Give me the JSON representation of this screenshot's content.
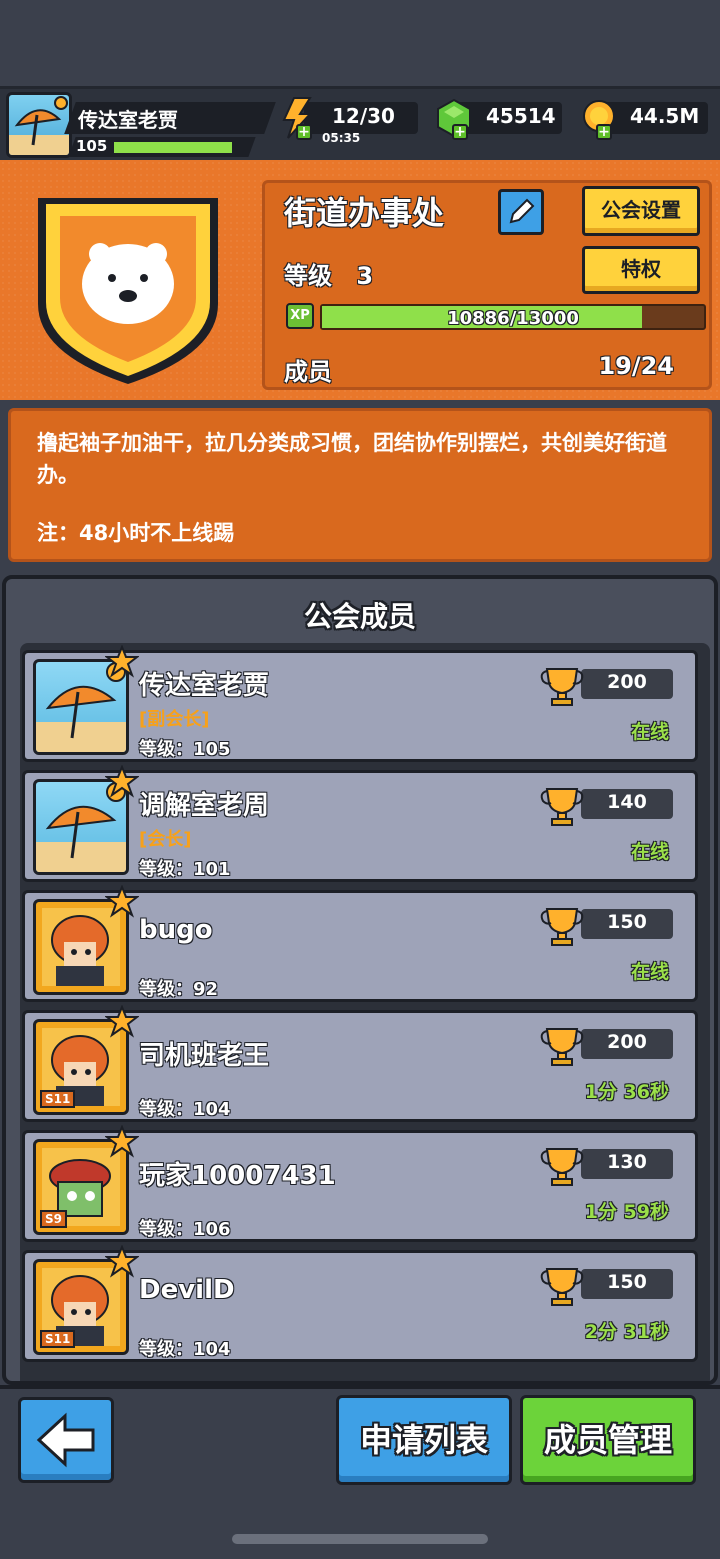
{
  "player": {
    "name": "传达室老贾",
    "level": "105",
    "level_progress": 0.92
  },
  "resources": {
    "energy": "12/30",
    "energy_timer": "05:35",
    "gems": "45514",
    "coins": "44.5M"
  },
  "guild": {
    "name": "街道办事处",
    "settings_label": "公会设置",
    "privilege_label": "特权",
    "level_label": "等级",
    "level": "3",
    "xp_badge": "XP",
    "xp_text": "10886/13000",
    "xp_progress": 0.837,
    "members_label": "成员",
    "members_value": "19/24",
    "description": "撸起袖子加油干，拉几分类成习惯，团结协作别摆烂，共创美好街道办。",
    "note": "注：48小时不上线踢"
  },
  "members_panel": {
    "title": "公会成员",
    "members": [
      {
        "name": "传达室老贾",
        "role": "[副会长]",
        "level": "等级：105",
        "trophies": "200",
        "status": "在线"
      },
      {
        "name": "调解室老周",
        "role": "[会长]",
        "level": "等级：101",
        "trophies": "140",
        "status": "在线"
      },
      {
        "name": "bugo",
        "role": "",
        "level": "等级：92",
        "trophies": "150",
        "status": "在线"
      },
      {
        "name": "司机班老王",
        "role": "",
        "level": "等级：104",
        "trophies": "200",
        "status": "1分 36秒",
        "season": "S11"
      },
      {
        "name": "玩家10007431",
        "role": "",
        "level": "等级：106",
        "trophies": "130",
        "status": "1分 59秒",
        "season": "S9"
      },
      {
        "name": "DevilD",
        "role": "",
        "level": "等级：104",
        "trophies": "150",
        "status": "2分 31秒",
        "season": "S11"
      }
    ]
  },
  "bottom": {
    "apply_list": "申请列表",
    "member_manage": "成员管理"
  },
  "colors": {
    "orange": "#e9772a",
    "green": "#8fe04a",
    "blue": "#3ea0e6",
    "yellow": "#ffd23c",
    "card": "#9ea3b8"
  }
}
